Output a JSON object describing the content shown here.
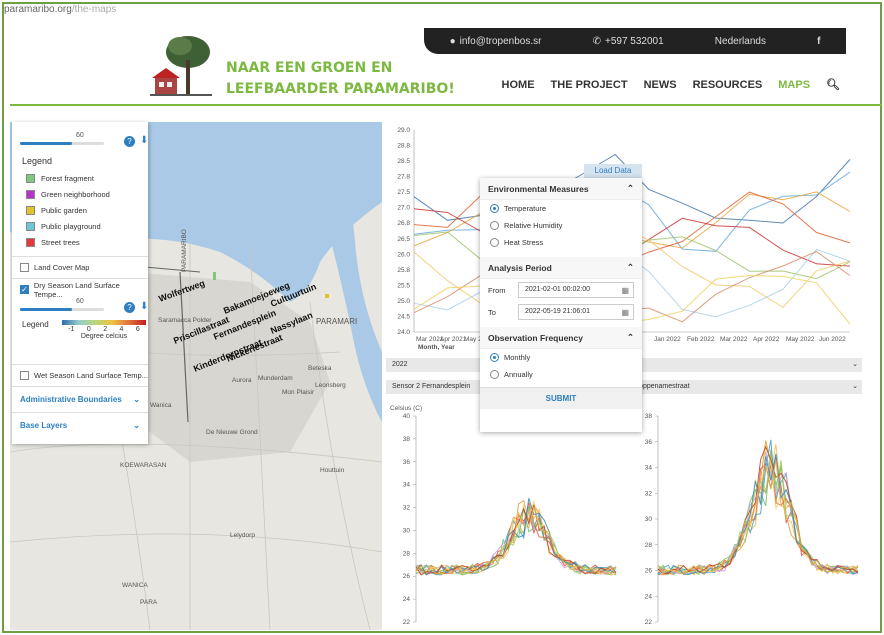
{
  "browser": {
    "url": "paramaribo.org",
    "url_path": "/the-maps"
  },
  "topbar": {
    "email": "info@tropenbos.sr",
    "phone": "+597 532001",
    "language": "Nederlands",
    "social": "f"
  },
  "site": {
    "title_line1": "NAAR EEN GROEN EN",
    "title_line2": "LEEFBAARDER PARAMARIBO!"
  },
  "nav": {
    "items": [
      "HOME",
      "THE PROJECT",
      "NEWS",
      "RESOURCES",
      "MAPS"
    ],
    "active": "MAPS"
  },
  "layers": {
    "top_opacity": "60",
    "legend_title": "Legend",
    "legend_items": [
      {
        "label": "Forest fragment",
        "color": "#7fc97f"
      },
      {
        "label": "Green neighborhood",
        "color": "#b832c8"
      },
      {
        "label": "Public garden",
        "color": "#e6c229"
      },
      {
        "label": "Public playground",
        "color": "#6ec6d6"
      },
      {
        "label": "Street trees",
        "color": "#e23a3a"
      }
    ],
    "land_cover": "Land Cover Map",
    "dry_season": "Dry Season Land Surface Tempe...",
    "dry_opacity": "60",
    "dry_legend_title": "Legend",
    "dry_ticks": [
      "-1",
      "0",
      "2",
      "4",
      "6"
    ],
    "dry_unit": "Degree celcius",
    "wet_season": "Wet Season Land Surface Temp...",
    "admin": "Administrative Boundaries",
    "base": "Base Layers"
  },
  "map_labels": {
    "roads": [
      "Wolfertweg",
      "Bakamoejoeweg",
      "Cultuurtuin",
      "Priscillastraat",
      "Fernandesplein",
      "Nassylaan",
      "Kinderdorpstraat",
      "Nickeriestraat"
    ],
    "places": [
      "PARAMARIBO",
      "PARAMARI",
      "Beteska",
      "Saramacca Polder",
      "Aurora",
      "Munderdam",
      "Wanica",
      "De Nieuwe Grond",
      "Houttuin",
      "Lelydorp",
      "KOEWARASAN",
      "PARA",
      "WANICA",
      "Leonsberg",
      "Mon Plaisir"
    ]
  },
  "panel": {
    "load_data": "Load Data",
    "env_title": "Environmental Measures",
    "env_options": [
      "Temperature",
      "Relative Humidity",
      "Heat Stress"
    ],
    "env_selected": "Temperature",
    "period_title": "Analysis Period",
    "from_label": "From",
    "from_value": "2021-02-01 00:02:00",
    "to_label": "To",
    "to_value": "2022-05-19 21:06:01",
    "freq_title": "Observation Frequency",
    "freq_options": [
      "Monthly",
      "Annually"
    ],
    "freq_selected": "Monthly",
    "submit": "SUBMIT"
  },
  "selectors": {
    "year": "2022",
    "sensor_left": "Sensor 2 Fernandesplein",
    "sensor_right": "Coppenamestraat"
  },
  "chart_data": [
    {
      "type": "line",
      "xlabel": "Month, Year",
      "ylim": [
        24.0,
        29.0
      ],
      "y_ticks": [
        "29.0",
        "28.8",
        "28.5",
        "27.8",
        "27.5",
        "27.0",
        "26.8",
        "26.5",
        "26.0",
        "25.8",
        "25.5",
        "25.0",
        "24.5",
        "24.0"
      ],
      "x_ticks": [
        "Mar 2021",
        "Apr 2021",
        "May 2021",
        "Jun 2021"
      ],
      "x_ticks_right": [
        "Jan 2022",
        "Feb 2022",
        "Mar 2022",
        "Apr 2022",
        "May 2022",
        "Jun 2022"
      ],
      "series_colors": [
        "#4477aa",
        "#66aadd",
        "#e8a33d",
        "#e06030",
        "#cc3333",
        "#9ec46a",
        "#f2c96b",
        "#aad0e8",
        "#d98c6a",
        "#f0d060"
      ]
    },
    {
      "type": "line",
      "title": "Sensor 2 Fernandesplein",
      "ylabel": "Celsius (C)",
      "ylim": [
        22,
        40
      ],
      "y_ticks": [
        "40",
        "38",
        "36",
        "34",
        "32",
        "30",
        "28",
        "26",
        "24",
        "22"
      ]
    },
    {
      "type": "line",
      "title": "Coppenamestraat",
      "ylabel": "(C)",
      "ylim": [
        22,
        38
      ],
      "y_ticks": [
        "38",
        "36",
        "34",
        "32",
        "30",
        "28",
        "26",
        "24",
        "22"
      ]
    }
  ]
}
